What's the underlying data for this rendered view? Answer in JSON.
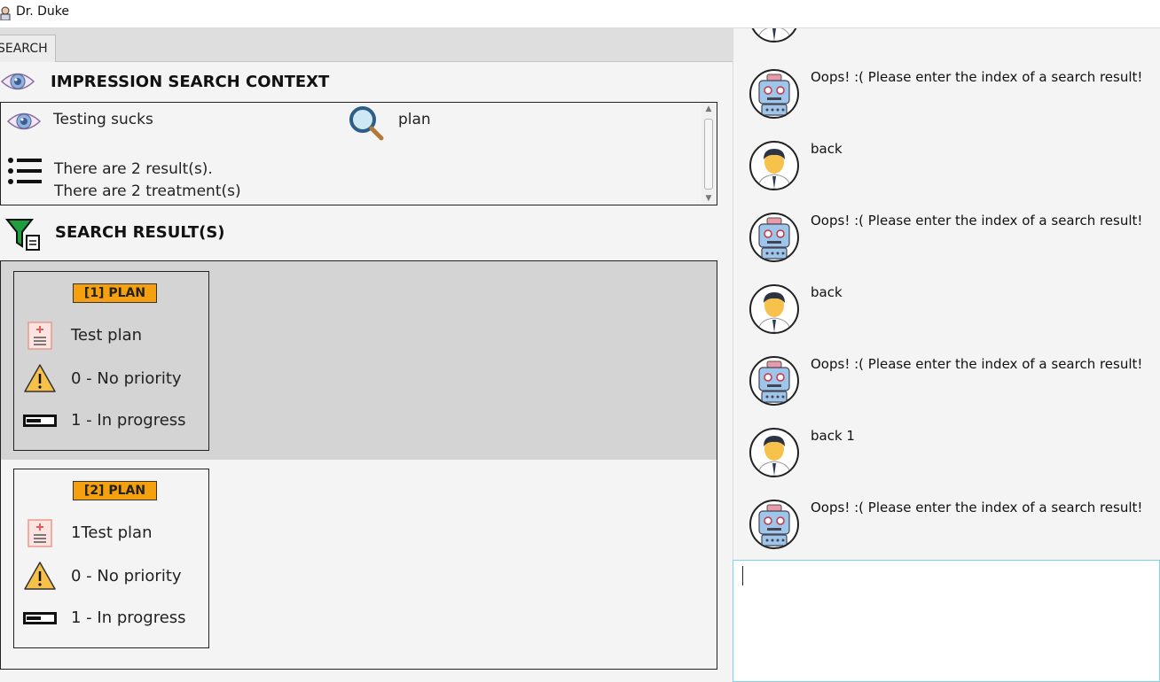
{
  "window": {
    "title": "Dr. Duke",
    "icon": "doctor-app-icon"
  },
  "tab": {
    "label": "SEARCH"
  },
  "context": {
    "header": "IMPRESSION SEARCH CONTEXT",
    "impression": "Testing sucks",
    "search_term": "plan",
    "result_count": "There are 2 result(s).",
    "treatment_count": "There are 2 treatment(s)"
  },
  "results": {
    "header": "SEARCH RESULT(S)",
    "items": [
      {
        "badge": "[1] PLAN",
        "name": "Test plan",
        "priority": "0 - No priority",
        "status": "1 - In progress",
        "selected": true
      },
      {
        "badge": "[2] PLAN",
        "name": "1Test plan",
        "priority": "0 - No priority",
        "status": "1 - In progress",
        "selected": false
      }
    ]
  },
  "chat": {
    "messages": [
      {
        "sender": "user",
        "text": ""
      },
      {
        "sender": "bot",
        "text": "Oops! :( Please enter the index of a search result!"
      },
      {
        "sender": "user",
        "text": "back"
      },
      {
        "sender": "bot",
        "text": "Oops! :( Please enter the index of a search result!"
      },
      {
        "sender": "user",
        "text": "back"
      },
      {
        "sender": "bot",
        "text": "Oops! :( Please enter the index of a search result!"
      },
      {
        "sender": "user",
        "text": "back 1"
      },
      {
        "sender": "bot",
        "text": "Oops! :( Please enter the index of a search result!"
      }
    ]
  },
  "input": {
    "value": ""
  },
  "colors": {
    "badge": "#f5a00e",
    "selected_row": "#d4d4d4",
    "input_border": "#7fd3e6"
  }
}
